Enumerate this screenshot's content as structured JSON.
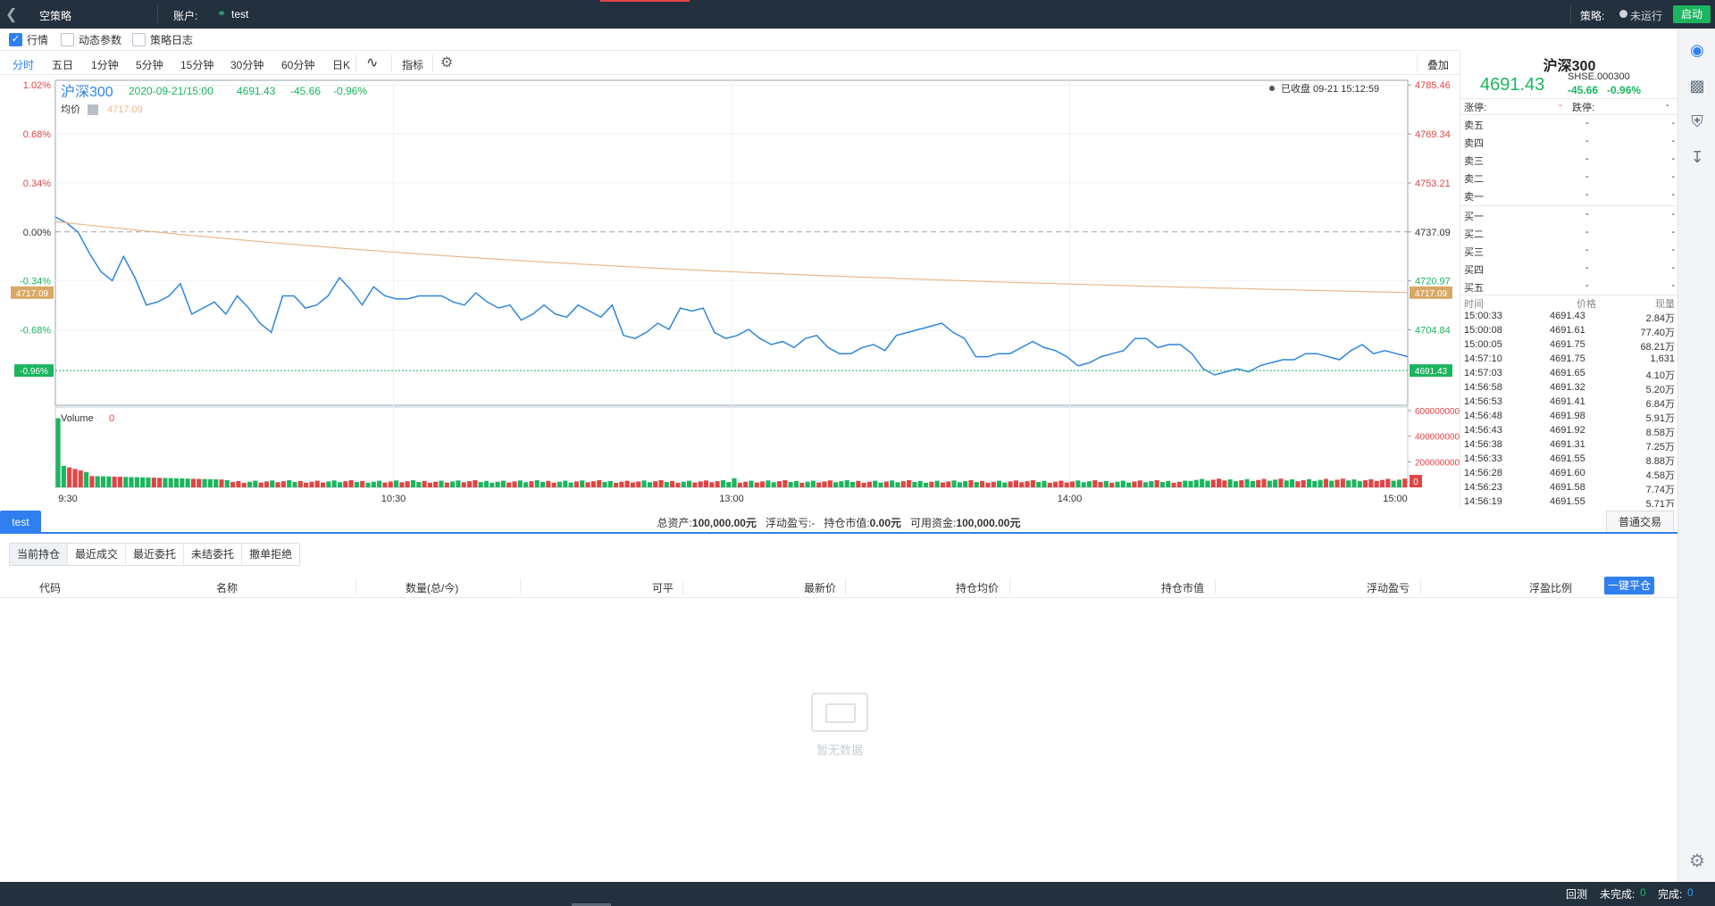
{
  "topbar": {
    "title": "空策略",
    "account_label": "账户:",
    "account_name": "test",
    "strategy_label": "策略:",
    "status": "未运行",
    "start_button": "启动"
  },
  "checkboxes": [
    {
      "label": "行情",
      "checked": true
    },
    {
      "label": "动态参数",
      "checked": false
    },
    {
      "label": "策略日志",
      "checked": false
    }
  ],
  "toolbar": {
    "periods": [
      "分时",
      "五日",
      "1分钟",
      "5分钟",
      "15分钟",
      "30分钟",
      "60分钟",
      "日K"
    ],
    "active": "分时",
    "indicator": "指标",
    "overlay": "叠加"
  },
  "chart_header": {
    "symbol": "沪深300",
    "datetime": "2020-09-21/15:00",
    "price": "4691.43",
    "change": "-45.66",
    "change_pct": "-0.96%",
    "avg_label": "均价",
    "avg_value": "4717.09",
    "market_status": "已收盘 09-21 15:12:59"
  },
  "colors": {
    "up": "#e04545",
    "down": "#1bb55f",
    "line": "#2f86dd",
    "avg": "#e8b98d",
    "accent": "#2f7ff0"
  },
  "chart_data": {
    "type": "line",
    "title": "沪深300",
    "x_ticks": [
      "9:30",
      "10:30",
      "13:00",
      "14:00",
      "15:00"
    ],
    "left_ticks": [
      "1.02%",
      "0.68%",
      "0.34%",
      "0.00%",
      "-0.34%",
      "-0.68%"
    ],
    "right_ticks": [
      "4785.46",
      "4769.34",
      "4753.21",
      "4737.09",
      "4720.97",
      "4704.84"
    ],
    "prev_close": 4737.09,
    "ylim": [
      4680,
      4787
    ],
    "avg_label_tag": "4717.09",
    "last_tag_left": "-0.96%",
    "last_tag_right": "4691.43",
    "price_series": [
      4742.0,
      4740,
      4737,
      4730,
      4724,
      4721,
      4729,
      4722,
      4713,
      4714,
      4716,
      4720,
      4710,
      4712,
      4714,
      4710,
      4716,
      4712,
      4707,
      4704,
      4716,
      4716,
      4712,
      4713,
      4716,
      4722,
      4718,
      4713,
      4719,
      4716,
      4715,
      4715,
      4716,
      4716,
      4716,
      4714,
      4713,
      4717,
      4714,
      4712,
      4713,
      4708,
      4710,
      4713,
      4710,
      4709,
      4713,
      4711,
      4709,
      4713,
      4703,
      4702,
      4704,
      4707,
      4705,
      4712,
      4711,
      4712,
      4704,
      4702,
      4703,
      4705,
      4702,
      4700,
      4701,
      4699,
      4702,
      4703,
      4699,
      4697,
      4697,
      4699,
      4700,
      4698,
      4703,
      4704,
      4705,
      4706,
      4707,
      4704,
      4702,
      4696,
      4696,
      4697,
      4697,
      4699,
      4701,
      4699,
      4698,
      4696,
      4693,
      4694,
      4696,
      4697,
      4698,
      4702,
      4702,
      4699,
      4700,
      4700,
      4697,
      4692,
      4690,
      4691,
      4692,
      4691,
      4693,
      4694,
      4695,
      4695,
      4697,
      4697,
      4696,
      4695,
      4698,
      4700,
      4697,
      4698,
      4697,
      4696
    ],
    "avg_series_start": 4740.5,
    "avg_series_end": 4717.09,
    "volume_ticks": [
      "600000000",
      "400000000",
      "200000000"
    ],
    "volume_label": "Volume",
    "volume_value": "0",
    "volume_last_tag": "0",
    "volume_ylim": [
      0,
      600000000
    ]
  },
  "quote": {
    "name": "沪深300",
    "price": "4691.43",
    "code": "SHSE.000300",
    "change": "-45.66",
    "change_pct": "-0.96%",
    "limit_up_label": "涨停:",
    "limit_up": "-",
    "limit_down_label": "跌停:",
    "limit_down": "-",
    "sell": [
      {
        "label": "卖五",
        "price": "-",
        "vol": "-"
      },
      {
        "label": "卖四",
        "price": "-",
        "vol": "-"
      },
      {
        "label": "卖三",
        "price": "-",
        "vol": "-"
      },
      {
        "label": "卖二",
        "price": "-",
        "vol": "-"
      },
      {
        "label": "卖一",
        "price": "-",
        "vol": "-"
      }
    ],
    "buy": [
      {
        "label": "买一",
        "price": "-",
        "vol": "-"
      },
      {
        "label": "买二",
        "price": "-",
        "vol": "-"
      },
      {
        "label": "买三",
        "price": "-",
        "vol": "-"
      },
      {
        "label": "买四",
        "price": "-",
        "vol": "-"
      },
      {
        "label": "买五",
        "price": "-",
        "vol": "-"
      }
    ],
    "ticks_header": {
      "time": "时间",
      "price": "价格",
      "vol": "现量"
    },
    "ticks": [
      {
        "t": "15:00:33",
        "p": "4691.43",
        "v": "2.84万"
      },
      {
        "t": "15:00:08",
        "p": "4691.61",
        "v": "77.40万"
      },
      {
        "t": "15:00:05",
        "p": "4691.75",
        "v": "68.21万"
      },
      {
        "t": "14:57:10",
        "p": "4691.75",
        "v": "1,631"
      },
      {
        "t": "14:57:03",
        "p": "4691.65",
        "v": "4.10万"
      },
      {
        "t": "14:56:58",
        "p": "4691.32",
        "v": "5.20万"
      },
      {
        "t": "14:56:53",
        "p": "4691.41",
        "v": "6.84万"
      },
      {
        "t": "14:56:48",
        "p": "4691.98",
        "v": "5.91万"
      },
      {
        "t": "14:56:43",
        "p": "4691.92",
        "v": "8.58万"
      },
      {
        "t": "14:56:38",
        "p": "4691.31",
        "v": "7.25万"
      },
      {
        "t": "14:56:33",
        "p": "4691.55",
        "v": "8.88万"
      },
      {
        "t": "14:56:28",
        "p": "4691.60",
        "v": "4.58万"
      },
      {
        "t": "14:56:23",
        "p": "4691.58",
        "v": "7.74万"
      },
      {
        "t": "14:56:19",
        "p": "4691.55",
        "v": "5.71万"
      }
    ]
  },
  "account_bar": {
    "tab": "test",
    "total_label": "总资产:",
    "total": "100,000.00元",
    "float_label": "浮动盈亏:",
    "float": "-",
    "mv_label": "持仓市值:",
    "mv": "0.00元",
    "avail_label": "可用资金:",
    "avail": "100,000.00元",
    "normal_trade": "普通交易"
  },
  "subtabs": [
    "当前持仓",
    "最近成交",
    "最近委托",
    "未结委托",
    "撤单拒绝"
  ],
  "table_headers": [
    "代码",
    "名称",
    "数量(总/今)",
    "可平",
    "最新价",
    "持仓均价",
    "持仓市值",
    "浮动盈亏",
    "浮盈比例"
  ],
  "close_all": "一键平仓",
  "empty_text": "暂无数据",
  "statusbar": {
    "backtest": "回测",
    "unfinished_label": "未完成:",
    "unfinished": "0",
    "finished_label": "完成:",
    "finished": "0"
  }
}
